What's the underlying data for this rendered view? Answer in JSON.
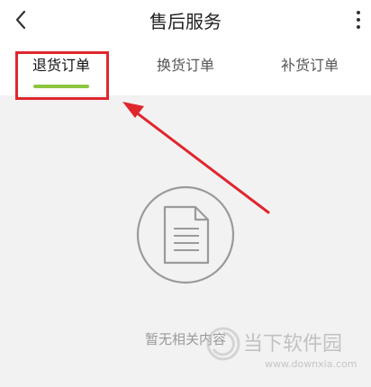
{
  "header": {
    "title": "售后服务",
    "back_icon": "chevron-left-icon",
    "more_icon": "more-vertical-icon"
  },
  "tabs": [
    {
      "label": "退货订单",
      "active": true
    },
    {
      "label": "换货订单",
      "active": false
    },
    {
      "label": "补货订单",
      "active": false
    }
  ],
  "colors": {
    "accent": "#8cc63f",
    "annotation": "#e0262d"
  },
  "empty_state": {
    "icon": "document-icon",
    "text": "暂无相关内容"
  },
  "watermark": {
    "name": "当下软件园",
    "url": "www.downxia.com"
  }
}
